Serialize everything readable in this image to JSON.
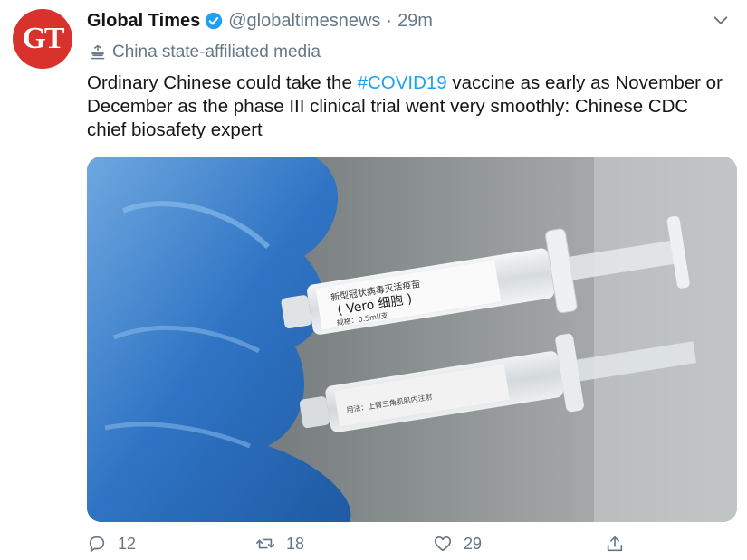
{
  "tweet": {
    "avatar_text": "GT",
    "author_name": "Global Times",
    "handle": "@globaltimesnews",
    "separator": "·",
    "time": "29m",
    "affiliation": "China state-affiliated media",
    "text_before": "Ordinary Chinese could take the ",
    "hashtag": "#COVID19",
    "text_after": " vaccine as early as November or December as the phase III clinical trial went very smoothly: Chinese CDC chief biosafety expert",
    "media": {
      "label_line1": "新型冠状病毒灭活疫苗",
      "label_line2": "( Vero 细胞 )",
      "label_line3": "规格：0.5ml/支",
      "label_line4": "用法：上臂三角肌肌内注射"
    },
    "actions": {
      "reply_count": "12",
      "retweet_count": "18",
      "like_count": "29"
    }
  },
  "colors": {
    "brand_red": "#d9322c",
    "link_blue": "#1da1f2",
    "muted": "#657786",
    "verified_blue": "#1da1f2"
  },
  "icons": [
    "verified-badge-icon",
    "chevron-down-icon",
    "state-media-icon",
    "reply-icon",
    "retweet-icon",
    "like-icon",
    "share-icon"
  ]
}
